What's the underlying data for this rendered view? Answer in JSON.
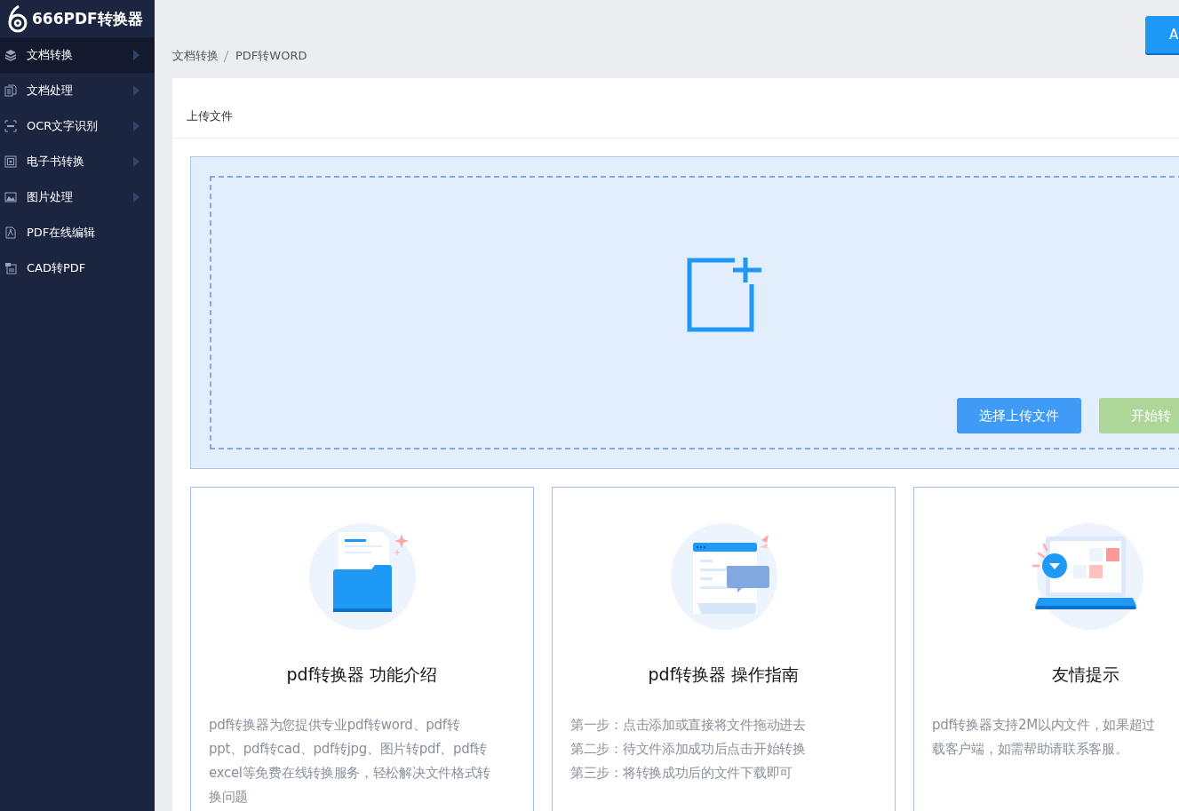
{
  "app": {
    "name": "666PDF转换器"
  },
  "sidebar": {
    "items": [
      {
        "label": "文档转换",
        "selected": true,
        "has_submenu": true
      },
      {
        "label": "文档处理",
        "selected": false,
        "has_submenu": true
      },
      {
        "label": "OCR文字识别",
        "selected": false,
        "has_submenu": true
      },
      {
        "label": "电子书转换",
        "selected": false,
        "has_submenu": true
      },
      {
        "label": "图片处理",
        "selected": false,
        "has_submenu": true
      },
      {
        "label": "PDF在线编辑",
        "selected": false,
        "has_submenu": false
      },
      {
        "label": "CAD转PDF",
        "selected": false,
        "has_submenu": false
      }
    ]
  },
  "breadcrumb": [
    "文档转换",
    "PDF转WORD"
  ],
  "header_button": "A",
  "panel": {
    "title": "上传文件",
    "buttons": [
      {
        "label": "选择上传文件",
        "kind": "primary"
      },
      {
        "label": "开始转",
        "kind": "success"
      }
    ]
  },
  "cards": [
    {
      "title": "pdf转换器 功能介绍",
      "lines": [
        "pdf转换器为您提供专业pdf转word、pdf转",
        "ppt、pdf转cad、pdf转jpg、图片转pdf、pdf转",
        "excel等免费在线转换服务，轻松解决文件格式转",
        "换问题"
      ]
    },
    {
      "title": "pdf转换器 操作指南",
      "lines": [
        "第一步：点击添加或直接将文件拖动进去",
        "第二步：待文件添加成功后点击开始转换",
        "第三步：将转换成功后的文件下载即可"
      ]
    },
    {
      "title": "友情提示",
      "lines": [
        "pdf转换器支持2M以内文件，如果超过",
        "载客户端，如需帮助请联系客服。"
      ]
    }
  ]
}
